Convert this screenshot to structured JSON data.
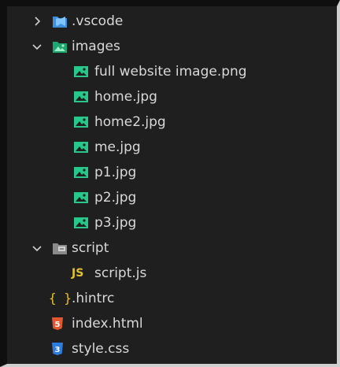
{
  "explorer": {
    "items": [
      {
        "label": ".vscode",
        "kind": "folder",
        "expanded": false,
        "depth": 0
      },
      {
        "label": "images",
        "kind": "folder",
        "expanded": true,
        "depth": 0
      },
      {
        "label": "full website image.png",
        "kind": "image",
        "depth": 1
      },
      {
        "label": "home.jpg",
        "kind": "image",
        "depth": 1
      },
      {
        "label": "home2.jpg",
        "kind": "image",
        "depth": 1
      },
      {
        "label": "me.jpg",
        "kind": "image",
        "depth": 1
      },
      {
        "label": "p1.jpg",
        "kind": "image",
        "depth": 1
      },
      {
        "label": "p2.jpg",
        "kind": "image",
        "depth": 1
      },
      {
        "label": "p3.jpg",
        "kind": "image",
        "depth": 1
      },
      {
        "label": "script",
        "kind": "folder",
        "expanded": true,
        "depth": 0
      },
      {
        "label": "script.js",
        "kind": "js",
        "badge": "JS",
        "depth": 1
      },
      {
        "label": ".hintrc",
        "kind": "config",
        "badge": "{ }",
        "depth": 0
      },
      {
        "label": "index.html",
        "kind": "html",
        "badge": "5",
        "depth": 0
      },
      {
        "label": "style.css",
        "kind": "css",
        "badge": "3",
        "depth": 0
      }
    ]
  },
  "colors": {
    "background": "#1f1f1f",
    "text": "#d8d8d8",
    "vscode_folder": "#3f8fdc",
    "image_icon": "#27c98a",
    "js_badge": "#e6c12a",
    "html_badge": "#e4572e",
    "css_badge": "#2b7de0"
  }
}
